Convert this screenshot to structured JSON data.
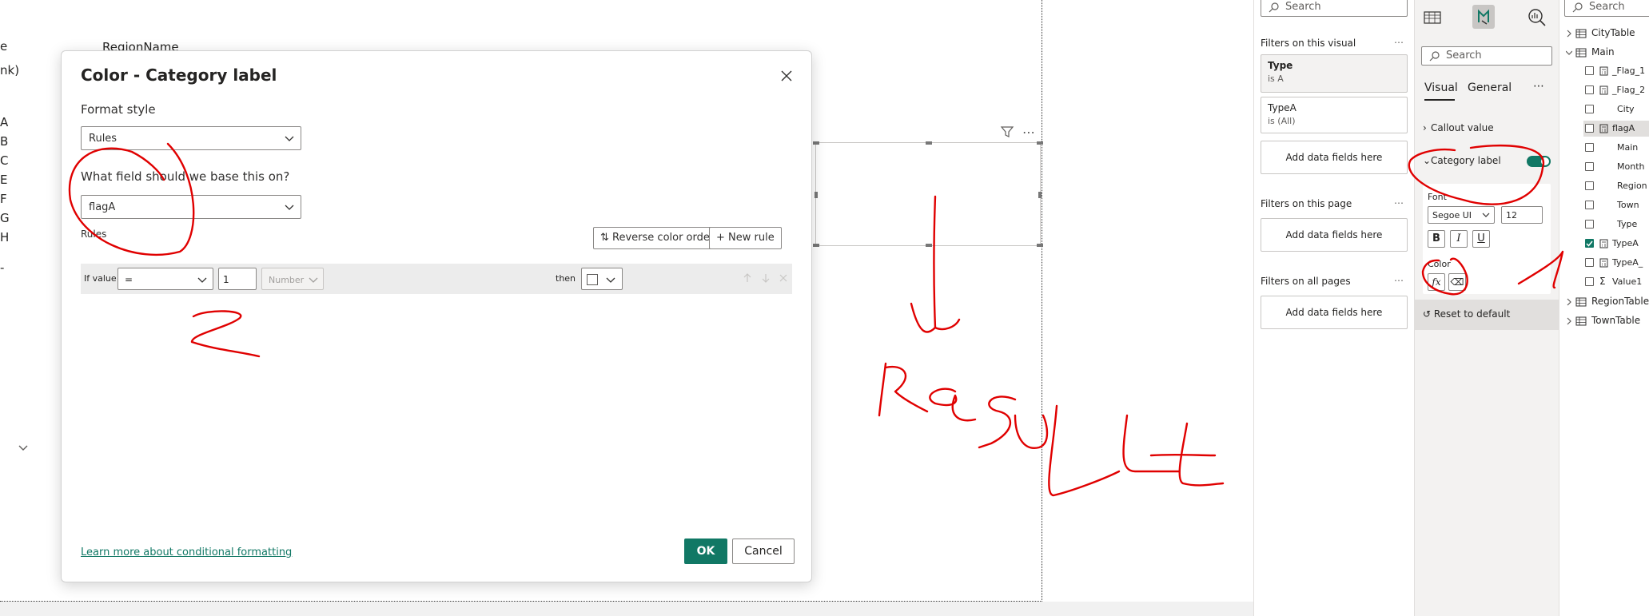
{
  "canvas": {
    "column_partial": "e",
    "column_header": "RegionName",
    "blank_partial": "nk)",
    "rows": [
      "A",
      "B",
      "C",
      "E",
      "F",
      "G",
      "H",
      "-"
    ]
  },
  "dialog": {
    "title": "Color - Category label",
    "format_style_label": "Format style",
    "format_style_value": "Rules",
    "field_question": "What field should we base this on?",
    "field_value": "flagA",
    "rules_label": "Rules",
    "reverse_button": "Reverse color order",
    "new_rule_button": "New rule",
    "rule": {
      "if_label": "If value",
      "operator": "=",
      "value": "1",
      "type": "Number",
      "then_label": "then"
    },
    "learn_link": "Learn more about conditional formatting",
    "ok": "OK",
    "cancel": "Cancel"
  },
  "filters": {
    "search_placeholder": "Search",
    "on_visual": "Filters on this visual",
    "on_page": "Filters on this page",
    "on_all": "Filters on all pages",
    "cards": [
      {
        "name": "Type",
        "desc": "is A"
      },
      {
        "name": "TypeA",
        "desc": "is (All)"
      }
    ],
    "add_fields": "Add data fields here"
  },
  "format": {
    "search_placeholder": "Search",
    "tab_visual": "Visual",
    "tab_general": "General",
    "callout": "Callout value",
    "category": "Category label",
    "font_label": "Font",
    "font_value": "Segoe UI",
    "size_value": "12",
    "bold": "B",
    "italic": "I",
    "underline": "U",
    "color_label": "Color",
    "fx": "fx",
    "reset": "Reset to default"
  },
  "data": {
    "search_placeholder": "Search",
    "tables": [
      {
        "name": "CityTable"
      },
      {
        "name": "Main"
      }
    ],
    "fields": [
      {
        "name": "_Flag_1",
        "kind": "measure",
        "checked": false
      },
      {
        "name": "_Flag_2",
        "kind": "measure",
        "checked": false
      },
      {
        "name": "City",
        "kind": "field",
        "checked": false
      },
      {
        "name": "flagA",
        "kind": "measure",
        "checked": false
      },
      {
        "name": "Main",
        "kind": "field",
        "checked": false
      },
      {
        "name": "Month",
        "kind": "field",
        "checked": false
      },
      {
        "name": "Region",
        "kind": "field",
        "checked": false
      },
      {
        "name": "Town",
        "kind": "field",
        "checked": false
      },
      {
        "name": "Type",
        "kind": "field",
        "checked": false
      },
      {
        "name": "TypeA",
        "kind": "measure",
        "checked": true
      },
      {
        "name": "TypeA_",
        "kind": "measure",
        "checked": false
      },
      {
        "name": "Value1",
        "kind": "sum",
        "checked": false
      }
    ],
    "tables_after": [
      {
        "name": "RegionTable"
      },
      {
        "name": "TownTable"
      }
    ]
  },
  "annotations": {
    "label_2": "2",
    "label_1": "1",
    "result_text": "RESULt"
  },
  "colors": {
    "accent": "#117865",
    "annotation": "#e00000"
  }
}
